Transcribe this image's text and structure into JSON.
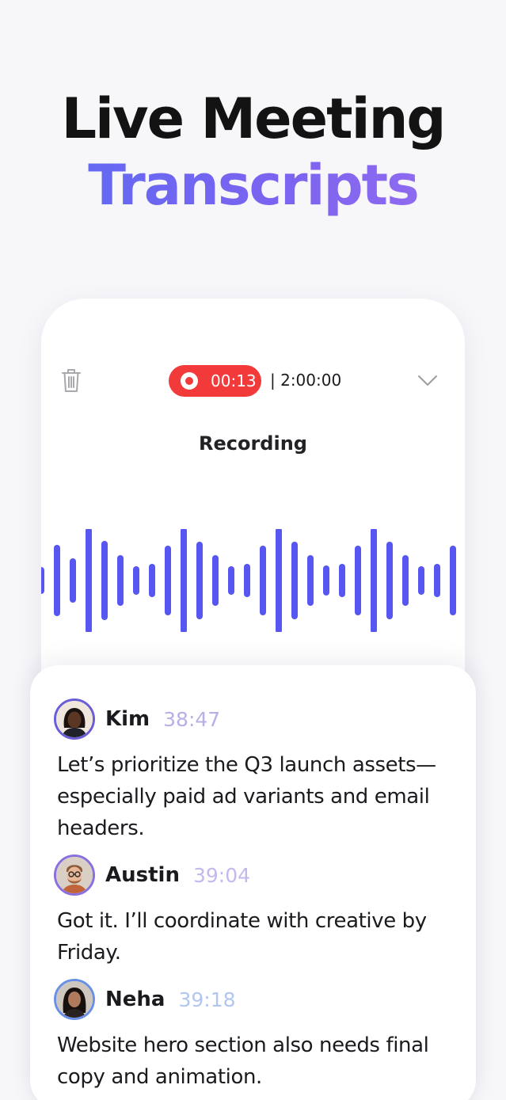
{
  "headline": {
    "line1": "Live Meeting",
    "line2": "Transcripts"
  },
  "recorder": {
    "elapsed": "00:13",
    "limit": "| 2:00:00",
    "status": "Recording",
    "icons": {
      "delete": "trash-icon",
      "record": "record-dot-icon",
      "collapse": "chevron-down-icon"
    },
    "colors": {
      "record_pill": "#f23a3a",
      "waveform": "#5856f0"
    }
  },
  "transcript": [
    {
      "name": "Kim",
      "time": "38:47",
      "time_color": "#b6b0e6",
      "ring_color": "#6a5ed8",
      "text": "Let’s prioritize the Q3 launch assets—especially paid ad variants and email headers."
    },
    {
      "name": "Austin",
      "time": "39:04",
      "time_color": "#c5b8ee",
      "ring_color": "#8a6fe0",
      "text": "Got it. I’ll coordinate with creative by Friday."
    },
    {
      "name": "Neha",
      "time": "39:18",
      "time_color": "#b1c6f1",
      "ring_color": "#6a8fe6",
      "text": "Website hero section also needs final copy and animation."
    }
  ]
}
